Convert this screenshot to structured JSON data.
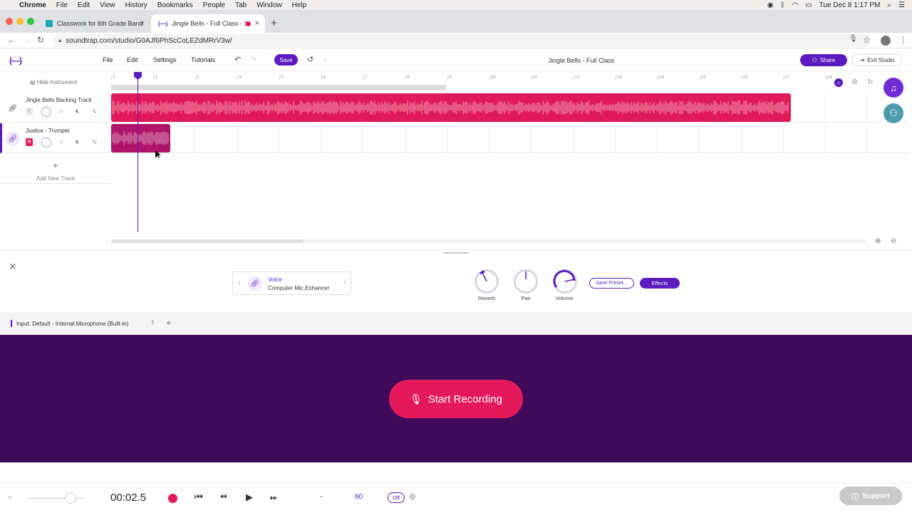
{
  "mac_menu": {
    "app": "Chrome",
    "items": [
      "File",
      "Edit",
      "View",
      "History",
      "Bookmarks",
      "People",
      "Tab",
      "Window",
      "Help"
    ],
    "clock": "Tue Dec 8  1:17 PM"
  },
  "browser": {
    "tabs": [
      {
        "title": "Classwork for 6th Grade Band",
        "favicon_color": "#1ba9b7"
      },
      {
        "title": "Jingle Bells - Full Class - S",
        "favicon_color": "#5b1bbf"
      }
    ],
    "url": "soundtrap.com/studio/G0AJf6PhScCoLEZdMRrV3w/"
  },
  "studio": {
    "logo": "(—)",
    "menu": [
      "File",
      "Edit",
      "Settings",
      "Tutorials"
    ],
    "save_label": "Save",
    "project_title": "Jingle Bells - Full Class",
    "share_label": "Share",
    "exit_label": "Exit Studio"
  },
  "tracks_panel": {
    "hide_instrument": "Hide Instrument",
    "add_track": "Add New Track",
    "tracks": [
      {
        "name": "Jingle Bells Backing Track",
        "record_label": "R",
        "armed": false
      },
      {
        "name": "Justice - Trumpet",
        "record_label": "R",
        "armed": true
      }
    ]
  },
  "timeline": {
    "bars": [
      "1",
      "2",
      "3",
      "4",
      "5",
      "6",
      "7",
      "8",
      "9",
      "10",
      "11",
      "12",
      "13",
      "14",
      "15",
      "16",
      "17",
      "18"
    ],
    "clip_colors": {
      "backing": "#e01a5a",
      "trumpet": "#b0146a"
    }
  },
  "instrument": {
    "category": "Voice",
    "preset": "Computer Mic Enhancer",
    "knobs": [
      "Reverb",
      "Pan",
      "Volume"
    ],
    "save_preset_label": "Save Preset...",
    "effects_label": "Effects",
    "input": "Input: Default - Internal Microphone (Built-in)"
  },
  "recording": {
    "start_label": "Start Recording"
  },
  "transport": {
    "time": "00:02.5",
    "tempo_sep": "-",
    "tempo": "60",
    "metronome": "Off",
    "support_label": "Support"
  },
  "colors": {
    "accent": "#5b1bbf",
    "record": "#e2185b",
    "rec_area_bg": "#3f0a5a"
  }
}
